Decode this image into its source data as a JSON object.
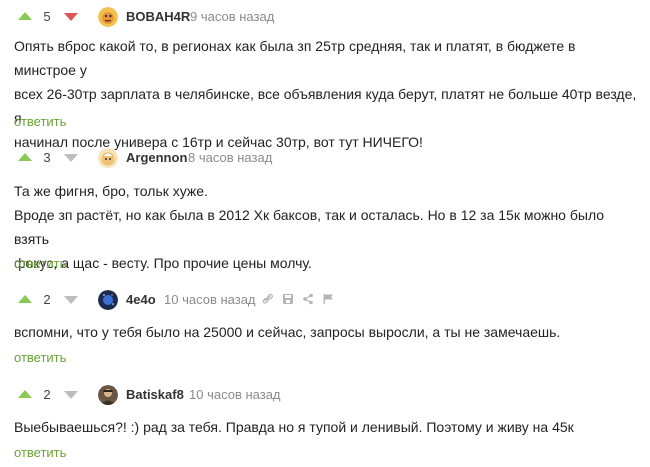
{
  "comments": [
    {
      "score": "5",
      "downvoted": true,
      "author": "BOBAH4R",
      "time": "9 часов назад",
      "lines": [
        "Опять вброс какой то, в регионах как была зп 25тр средняя, так и платят, в бюджете в минстрое у",
        "всех 26-30тр зарплата в челябинске, все объявления куда берут, платят не больше 40тр везде, я",
        "начинал после универа с 16тр и сейчас 30тр, вот тут НИЧЕГО!"
      ],
      "reply_label": "ответить"
    },
    {
      "score": "3",
      "downvoted": false,
      "author": "Argennon",
      "time": "8 часов назад",
      "lines": [
        "Та же фигня, бро, тольк хуже.",
        "Вроде зп растёт, но как была в 2012 Хк баксов, так и осталась. Но в 12 за 15к можно было взять",
        "фокус, а щас - весту. Про прочие цены молчу."
      ],
      "reply_label": "ответить"
    },
    {
      "score": "2",
      "downvoted": false,
      "author": "4e4o",
      "time": "10 часов назад",
      "tools": [
        "link-icon",
        "save-icon",
        "share-icon",
        "flag-icon"
      ],
      "lines": [
        "вспомни, что у тебя было на 25000 и сейчас, запросы выросли, а ты не замечаешь."
      ],
      "reply_label": "ответить"
    },
    {
      "score": "2",
      "downvoted": false,
      "author": "Batiskaf8",
      "time": "10 часов назад",
      "lines": [
        "Выебываешься?! :) рад за тебя. Правда но я тупой и ленивый. Поэтому и живу на 45к"
      ],
      "reply_label": "ответить"
    }
  ],
  "colors": {
    "upvote": "#8ac858",
    "downvote_active": "#e05556",
    "downvote": "#bdbdbd",
    "reply": "#6aa236",
    "time": "#8b8b8b"
  }
}
